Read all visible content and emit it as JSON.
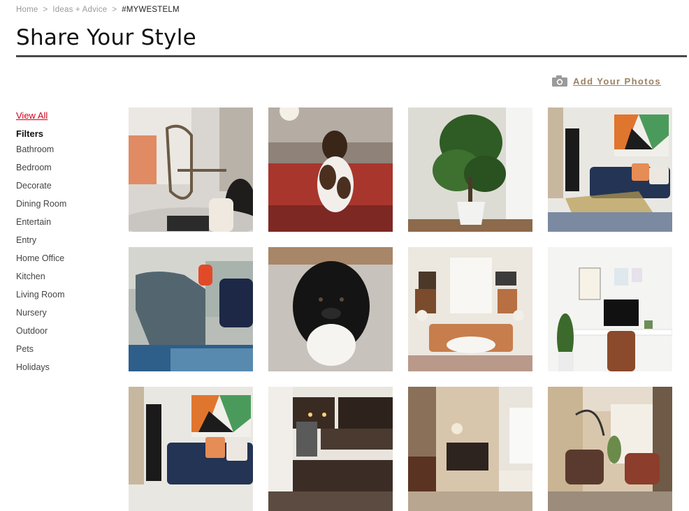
{
  "breadcrumb": {
    "items": [
      "Home",
      "Ideas + Advice"
    ],
    "separator": ">",
    "current": "#MYWESTELM"
  },
  "page": {
    "title": "Share Your Style"
  },
  "add_photos": {
    "label": "Add Your Photos",
    "icon": "camera-icon"
  },
  "sidebar": {
    "view_all": "View All",
    "filters_heading": "Filters",
    "filters": [
      "Bathroom",
      "Bedroom",
      "Decorate",
      "Dining Room",
      "Entertain",
      "Entry",
      "Home Office",
      "Kitchen",
      "Living Room",
      "Nursery",
      "Outdoor",
      "Pets",
      "Holidays"
    ]
  },
  "colors": {
    "accent_red": "#d0021b",
    "link_brown": "#9b8262",
    "title_rule": "#4a4a4a"
  }
}
